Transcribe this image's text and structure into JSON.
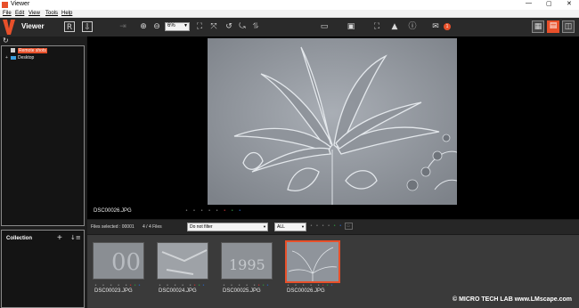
{
  "window": {
    "title": "Viewer"
  },
  "menu": [
    "File",
    "Edit",
    "View",
    "Tools",
    "Help"
  ],
  "toolbar": {
    "app_name": "Viewer",
    "zoom_value": "6%",
    "notification_count": "1"
  },
  "tree": {
    "items": [
      {
        "label": "Remote shots",
        "selected": true
      },
      {
        "label": "Desktop",
        "selected": false
      }
    ]
  },
  "collection": {
    "title": "Collection"
  },
  "viewer": {
    "filename": "DSC00026.JPG"
  },
  "filter": {
    "files_selected": "Files selected : 00001",
    "count": "4 / 4 Files",
    "filter_value": "Do not filter",
    "type_value": "ALL"
  },
  "thumbnails": [
    {
      "name": "DSC00023.JPG",
      "selected": false
    },
    {
      "name": "DSC00024.JPG",
      "selected": false
    },
    {
      "name": "DSC00025.JPG",
      "selected": false
    },
    {
      "name": "DSC00026.JPG",
      "selected": true
    }
  ],
  "watermark": "© MICRO TECH LAB www.LMscape.com",
  "colors": {
    "accent": "#e8502a",
    "background": "#000000",
    "panel": "#1e1e1e"
  }
}
